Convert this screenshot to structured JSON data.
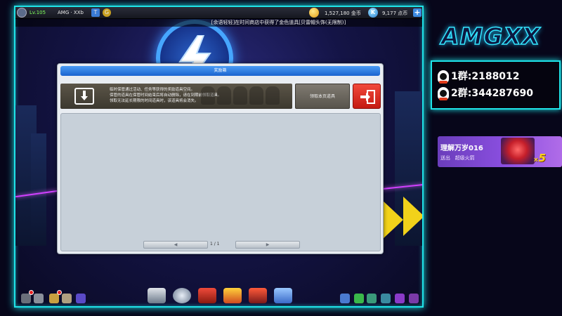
{
  "topbar": {
    "level": "Lv.105",
    "username": "AMG · XXb",
    "gold": "1,527,180 金币",
    "points": "9,177 点币",
    "k_icon": "K",
    "t_icon": "T",
    "g_icon": "G",
    "plus": "+"
  },
  "ticker": "[余语轻轻]在时间商店中获得了金色道具[贝雷帽头饰(无限制)]",
  "dialog": {
    "title": "奖励箱",
    "info_lines": [
      "临时保管通过活动、任务等获得的奖励道具空间。",
      "保管的道具在保管时间结束后将自动删除，请在到期前领取道具。",
      "领取无法延长期限的时间道具时，该道具将会消失。"
    ],
    "claim_button": "领取本页道具",
    "pager": {
      "prev": "◀",
      "next": "▶",
      "page": "1 / 1"
    }
  },
  "stream": {
    "brand": "AMGXX",
    "qq_groups": [
      "1群:2188012",
      "2群:344287690"
    ],
    "gift": {
      "sender": "理解万岁016",
      "action": "送出",
      "item": "超级火箭",
      "count": "5",
      "x": "×"
    }
  },
  "colors": {
    "neon_cyan": "#1fe3e8",
    "title_blue": "#1b64cf",
    "exit_red": "#e03a2c",
    "gift_purple": "#8b4fe0"
  }
}
